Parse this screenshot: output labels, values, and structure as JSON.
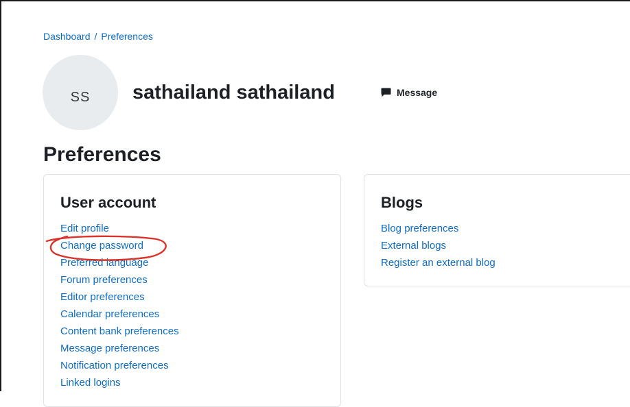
{
  "breadcrumb": {
    "items": [
      "Dashboard",
      "Preferences"
    ],
    "separator": "/"
  },
  "user": {
    "initials": "SS",
    "full_name": "sathailand sathailand",
    "message_label": "Message"
  },
  "page": {
    "title": "Preferences"
  },
  "user_account": {
    "heading": "User account",
    "links": [
      "Edit profile",
      "Change password",
      "Preferred language",
      "Forum preferences",
      "Editor preferences",
      "Calendar preferences",
      "Content bank preferences",
      "Message preferences",
      "Notification preferences",
      "Linked logins"
    ]
  },
  "blogs": {
    "heading": "Blogs",
    "links": [
      "Blog preferences",
      "External blogs",
      "Register an external blog"
    ]
  },
  "colors": {
    "link": "#0f6cbf",
    "annotation": "#d9342b",
    "text": "#1d2125",
    "avatar_bg": "#e9ecef"
  },
  "annotation": {
    "type": "hand-drawn ellipse",
    "target": "Change password"
  }
}
